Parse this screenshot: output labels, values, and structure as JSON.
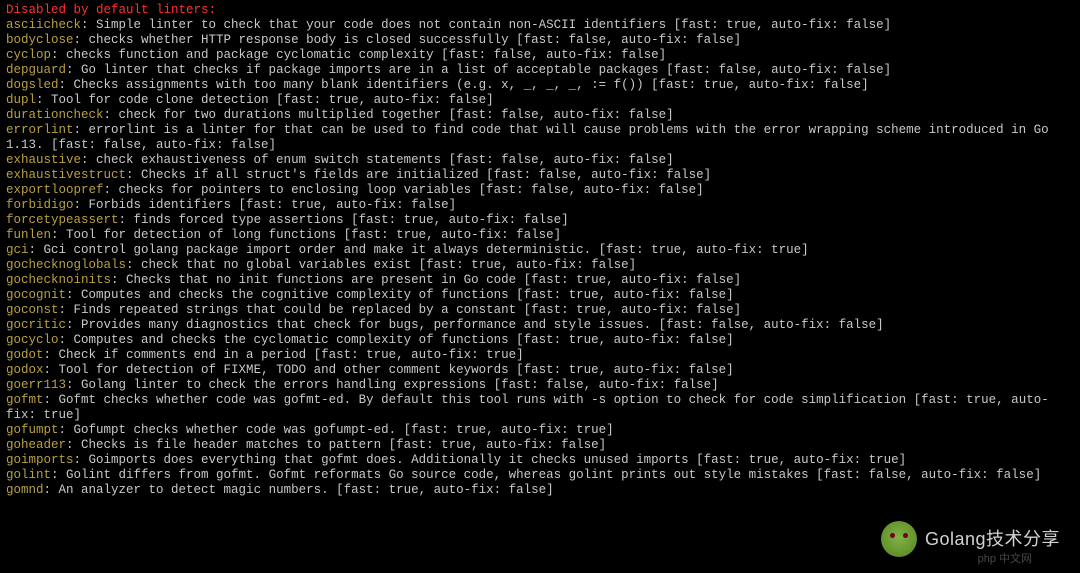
{
  "header": "Disabled by default linters:",
  "linters": [
    {
      "name": "asciicheck",
      "desc": "Simple linter to check that your code does not contain non-ASCII identifiers [fast: true, auto-fix: false]"
    },
    {
      "name": "bodyclose",
      "desc": "checks whether HTTP response body is closed successfully [fast: false, auto-fix: false]"
    },
    {
      "name": "cyclop",
      "desc": "checks function and package cyclomatic complexity [fast: false, auto-fix: false]"
    },
    {
      "name": "depguard",
      "desc": "Go linter that checks if package imports are in a list of acceptable packages [fast: false, auto-fix: false]"
    },
    {
      "name": "dogsled",
      "desc": "Checks assignments with too many blank identifiers (e.g. x, _, _, _, := f()) [fast: true, auto-fix: false]"
    },
    {
      "name": "dupl",
      "desc": "Tool for code clone detection [fast: true, auto-fix: false]"
    },
    {
      "name": "durationcheck",
      "desc": "check for two durations multiplied together [fast: false, auto-fix: false]"
    },
    {
      "name": "errorlint",
      "desc": "errorlint is a linter for that can be used to find code that will cause problems with the error wrapping scheme introduced in Go 1.13. [fast: false, auto-fix: false]"
    },
    {
      "name": "exhaustive",
      "desc": "check exhaustiveness of enum switch statements [fast: false, auto-fix: false]"
    },
    {
      "name": "exhaustivestruct",
      "desc": "Checks if all struct's fields are initialized [fast: false, auto-fix: false]"
    },
    {
      "name": "exportloopref",
      "desc": "checks for pointers to enclosing loop variables [fast: false, auto-fix: false]"
    },
    {
      "name": "forbidigo",
      "desc": "Forbids identifiers [fast: true, auto-fix: false]"
    },
    {
      "name": "forcetypeassert",
      "desc": "finds forced type assertions [fast: true, auto-fix: false]"
    },
    {
      "name": "funlen",
      "desc": "Tool for detection of long functions [fast: true, auto-fix: false]"
    },
    {
      "name": "gci",
      "desc": "Gci control golang package import order and make it always deterministic. [fast: true, auto-fix: true]"
    },
    {
      "name": "gochecknoglobals",
      "desc": "check that no global variables exist [fast: true, auto-fix: false]"
    },
    {
      "name": "gochecknoinits",
      "desc": "Checks that no init functions are present in Go code [fast: true, auto-fix: false]"
    },
    {
      "name": "gocognit",
      "desc": "Computes and checks the cognitive complexity of functions [fast: true, auto-fix: false]"
    },
    {
      "name": "goconst",
      "desc": "Finds repeated strings that could be replaced by a constant [fast: true, auto-fix: false]"
    },
    {
      "name": "gocritic",
      "desc": "Provides many diagnostics that check for bugs, performance and style issues. [fast: false, auto-fix: false]"
    },
    {
      "name": "gocyclo",
      "desc": "Computes and checks the cyclomatic complexity of functions [fast: true, auto-fix: false]"
    },
    {
      "name": "godot",
      "desc": "Check if comments end in a period [fast: true, auto-fix: true]"
    },
    {
      "name": "godox",
      "desc": "Tool for detection of FIXME, TODO and other comment keywords [fast: true, auto-fix: false]"
    },
    {
      "name": "goerr113",
      "desc": "Golang linter to check the errors handling expressions [fast: false, auto-fix: false]"
    },
    {
      "name": "gofmt",
      "desc": "Gofmt checks whether code was gofmt-ed. By default this tool runs with -s option to check for code simplification [fast: true, auto-fix: true]"
    },
    {
      "name": "gofumpt",
      "desc": "Gofumpt checks whether code was gofumpt-ed. [fast: true, auto-fix: true]"
    },
    {
      "name": "goheader",
      "desc": "Checks is file header matches to pattern [fast: true, auto-fix: false]"
    },
    {
      "name": "goimports",
      "desc": "Goimports does everything that gofmt does. Additionally it checks unused imports [fast: true, auto-fix: true]"
    },
    {
      "name": "golint",
      "desc": "Golint differs from gofmt. Gofmt reformats Go source code, whereas golint prints out style mistakes [fast: false, auto-fix: false]"
    },
    {
      "name": "gomnd",
      "desc": "An analyzer to detect magic numbers. [fast: true, auto-fix: false]"
    }
  ],
  "watermark": {
    "text": "Golang技术分享",
    "badge": "php 中文网"
  }
}
